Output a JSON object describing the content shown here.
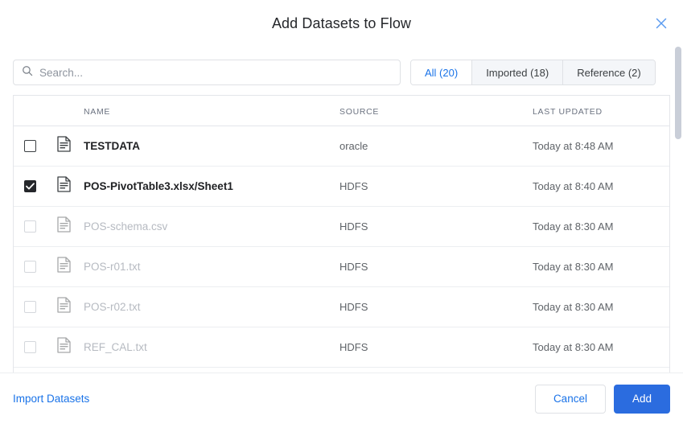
{
  "dialog": {
    "title": "Add Datasets to Flow",
    "close_icon": "close-icon"
  },
  "search": {
    "placeholder": "Search...",
    "value": "",
    "icon": "search-icon"
  },
  "tabs": [
    {
      "label": "All (20)",
      "active": true
    },
    {
      "label": "Imported (18)",
      "active": false
    },
    {
      "label": "Reference (2)",
      "active": false
    }
  ],
  "table": {
    "columns": [
      "NAME",
      "SOURCE",
      "LAST UPDATED"
    ],
    "rows": [
      {
        "name": "TESTDATA",
        "source": "oracle",
        "last_updated": "Today at 8:48 AM",
        "checked": false,
        "disabled": false,
        "icon": "file-document-icon"
      },
      {
        "name": "POS-PivotTable3.xlsx/Sheet1",
        "source": "HDFS",
        "last_updated": "Today at 8:40 AM",
        "checked": true,
        "disabled": false,
        "icon": "file-document-icon"
      },
      {
        "name": "POS-schema.csv",
        "source": "HDFS",
        "last_updated": "Today at 8:30 AM",
        "checked": false,
        "disabled": true,
        "icon": "file-document-icon"
      },
      {
        "name": "POS-r01.txt",
        "source": "HDFS",
        "last_updated": "Today at 8:30 AM",
        "checked": false,
        "disabled": true,
        "icon": "file-document-icon"
      },
      {
        "name": "POS-r02.txt",
        "source": "HDFS",
        "last_updated": "Today at 8:30 AM",
        "checked": false,
        "disabled": true,
        "icon": "file-document-icon"
      },
      {
        "name": "REF_CAL.txt",
        "source": "HDFS",
        "last_updated": "Today at 8:30 AM",
        "checked": false,
        "disabled": true,
        "icon": "file-document-icon"
      }
    ]
  },
  "footer": {
    "import_link": "Import Datasets",
    "cancel_label": "Cancel",
    "add_label": "Add"
  },
  "colors": {
    "accent_blue": "#1a73e8",
    "primary_button": "#2b6cdf",
    "checkbox_checked": "#25272b",
    "disabled_text": "#b6bac1",
    "muted_text": "#5f6368",
    "border": "#e4e6ea"
  }
}
